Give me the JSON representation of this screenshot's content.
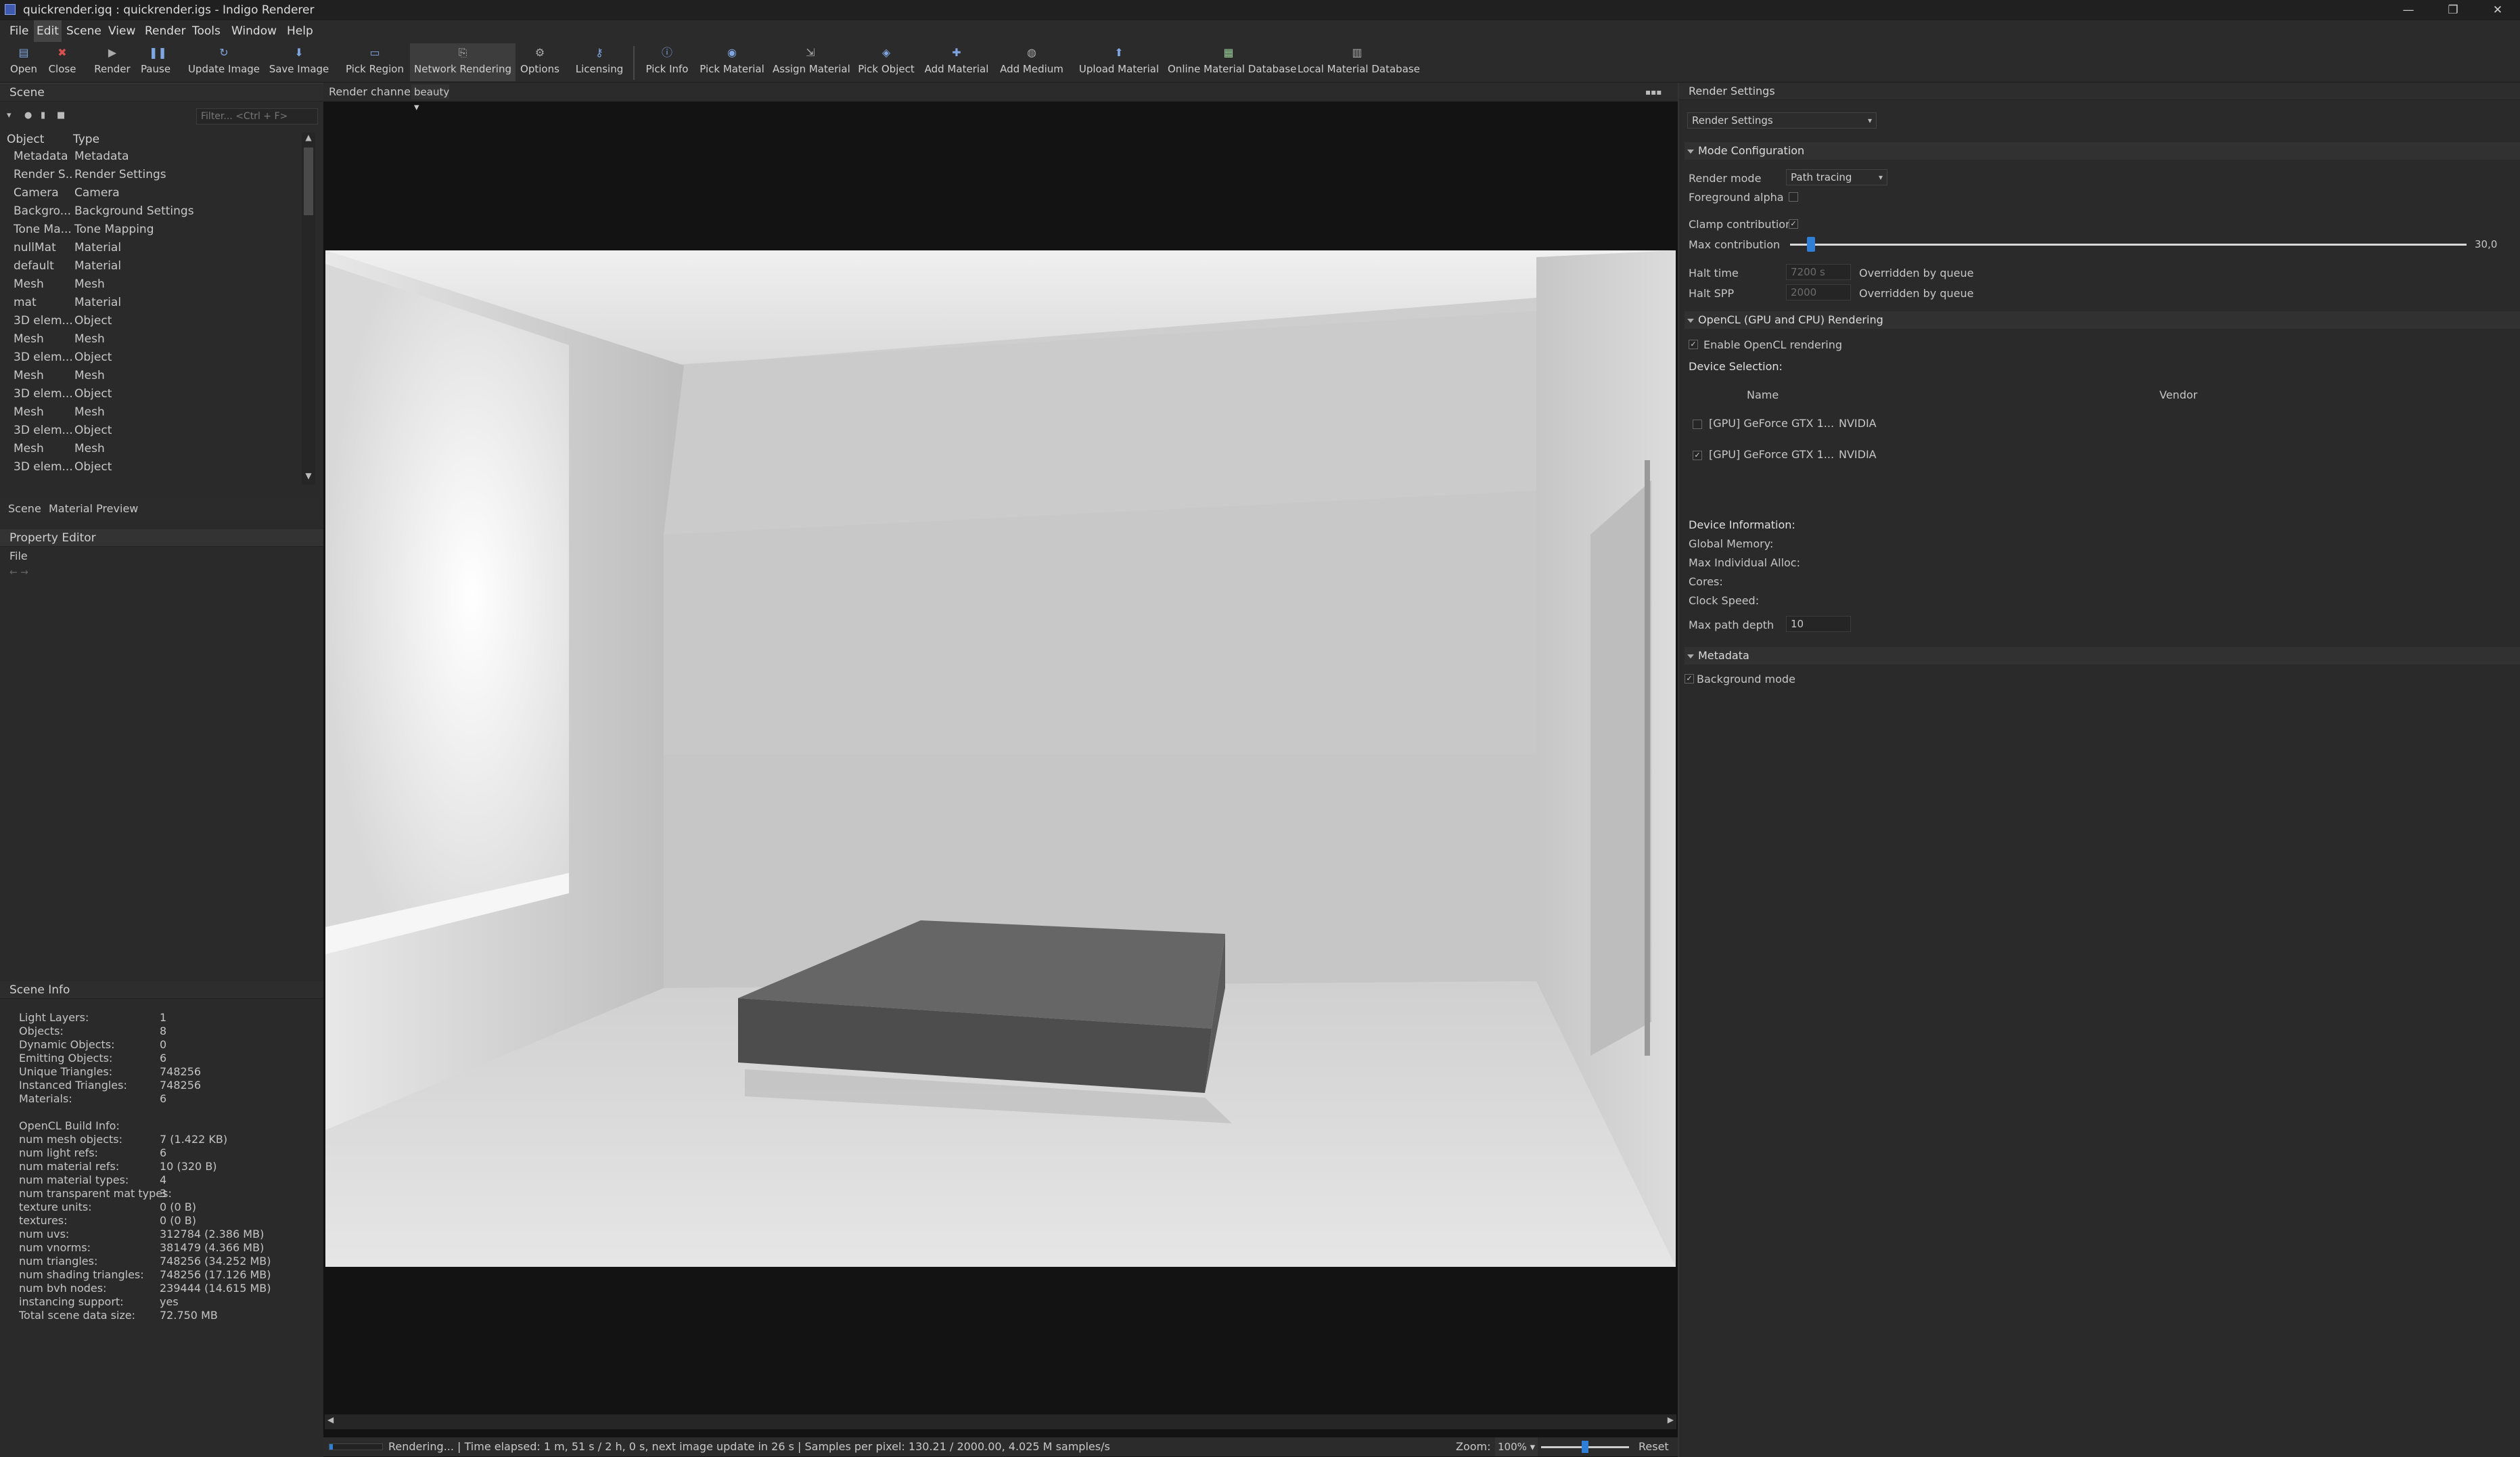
{
  "window": {
    "title": "quickrender.igq : quickrender.igs - Indigo Renderer",
    "controls": [
      "—",
      "❐",
      "✕"
    ]
  },
  "menu": [
    "File",
    "Edit",
    "Scene",
    "View",
    "Render",
    "Tools",
    "Window",
    "Help"
  ],
  "toolbar": {
    "buttons": [
      {
        "label": "Open",
        "icon": "folder-open-icon"
      },
      {
        "label": "Close",
        "icon": "close-icon"
      },
      {
        "label": "Render",
        "icon": "play-icon"
      },
      {
        "label": "Pause",
        "icon": "pause-icon"
      },
      {
        "label": "Update Image",
        "icon": "refresh-icon"
      },
      {
        "label": "Save Image",
        "icon": "save-icon"
      },
      {
        "label": "Pick Region",
        "icon": "region-icon"
      },
      {
        "label": "Network Rendering",
        "icon": "network-icon"
      },
      {
        "label": "Options",
        "icon": "gear-icon"
      },
      {
        "label": "Licensing",
        "icon": "key-icon"
      },
      {
        "label": "Pick Info",
        "icon": "info-icon"
      },
      {
        "label": "Pick Material",
        "icon": "material-icon"
      },
      {
        "label": "Assign Material",
        "icon": "assign-icon"
      },
      {
        "label": "Pick Object",
        "icon": "object-icon"
      },
      {
        "label": "Add Material",
        "icon": "add-material-icon"
      },
      {
        "label": "Add Medium",
        "icon": "medium-icon"
      },
      {
        "label": "Upload Material",
        "icon": "upload-icon"
      },
      {
        "label": "Online Material Database",
        "icon": "grid-icon"
      },
      {
        "label": "Local Material Database",
        "icon": "database-icon"
      }
    ]
  },
  "scene": {
    "panel_title": "Scene",
    "filter_placeholder": "Filter... <Ctrl + F>",
    "col_object": "Object",
    "col_type": "Type",
    "rows": [
      {
        "object": "Metadata",
        "type": "Metadata"
      },
      {
        "object": "Render S...",
        "type": "Render Settings"
      },
      {
        "object": "Camera",
        "type": "Camera"
      },
      {
        "object": "Backgro...",
        "type": "Background Settings"
      },
      {
        "object": "Tone Ma...",
        "type": "Tone Mapping"
      },
      {
        "object": "nullMat",
        "type": "Material"
      },
      {
        "object": "default",
        "type": "Material"
      },
      {
        "object": "Mesh",
        "type": "Mesh"
      },
      {
        "object": "mat",
        "type": "Material"
      },
      {
        "object": "3D elem...",
        "type": "Object"
      },
      {
        "object": "Mesh",
        "type": "Mesh"
      },
      {
        "object": "3D elem...",
        "type": "Object"
      },
      {
        "object": "Mesh",
        "type": "Mesh"
      },
      {
        "object": "3D elem...",
        "type": "Object"
      },
      {
        "object": "Mesh",
        "type": "Mesh"
      },
      {
        "object": "3D elem...",
        "type": "Object"
      },
      {
        "object": "Mesh",
        "type": "Mesh"
      },
      {
        "object": "3D elem...",
        "type": "Object"
      }
    ],
    "tabs": [
      "Scene",
      "Material Preview"
    ]
  },
  "property_editor": {
    "title": "Property Editor",
    "menu": "File",
    "nav": "← →"
  },
  "scene_info": {
    "title": "Scene Info",
    "rows": [
      {
        "k": "Light Layers:",
        "v": "1"
      },
      {
        "k": "Objects:",
        "v": "8"
      },
      {
        "k": "Dynamic Objects:",
        "v": "0"
      },
      {
        "k": "Emitting Objects:",
        "v": "6"
      },
      {
        "k": "Unique Triangles:",
        "v": "748256"
      },
      {
        "k": "Instanced Triangles:",
        "v": "748256"
      },
      {
        "k": "Materials:",
        "v": "6"
      },
      {
        "k": "",
        "v": ""
      },
      {
        "k": "OpenCL Build Info:",
        "v": ""
      },
      {
        "k": "num mesh objects:",
        "v": "7 (1.422 KB)"
      },
      {
        "k": "num light refs:",
        "v": "6"
      },
      {
        "k": "num material refs:",
        "v": "10 (320 B)"
      },
      {
        "k": "num material types:",
        "v": "4"
      },
      {
        "k": "num transparent mat types:",
        "v": "3"
      },
      {
        "k": "texture units:",
        "v": "0 (0 B)"
      },
      {
        "k": "textures:",
        "v": "0 (0 B)"
      },
      {
        "k": "num uvs:",
        "v": "312784 (2.386 MB)"
      },
      {
        "k": "num vnorms:",
        "v": "381479 (4.366 MB)"
      },
      {
        "k": "num triangles:",
        "v": "748256 (34.252 MB)"
      },
      {
        "k": "num shading triangles:",
        "v": "748256 (17.126 MB)"
      },
      {
        "k": "num bvh nodes:",
        "v": "239444 (14.615 MB)"
      },
      {
        "k": "instancing support:",
        "v": "yes"
      },
      {
        "k": "Total scene data size:",
        "v": "72.750 MB"
      }
    ]
  },
  "viewport": {
    "channel_label": "Render channel:",
    "channel_value": "beauty",
    "status": "Rendering... | Time elapsed: 1 m, 51 s / 2 h, 0 s, next image update in 26 s | Samples per pixel: 130.21 / 2000.00, 4.025 M samples/s",
    "zoom_label": "Zoom:",
    "zoom_value": "100%",
    "reset": "Reset"
  },
  "render_settings": {
    "title": "Render Settings",
    "selector": "Render Settings",
    "mode_config": "Mode Configuration",
    "render_mode_label": "Render mode",
    "render_mode_value": "Path tracing",
    "foreground_alpha": "Foreground alpha",
    "clamp_contributions": "Clamp contributions",
    "max_contribution": "Max contribution",
    "max_contribution_value": "30,0",
    "max_contribution_fraction": 0.025,
    "halt_time": "Halt time",
    "halt_time_value": "7200 s",
    "halt_spp": "Halt SPP",
    "halt_spp_value": "2000",
    "overridden": "Overridden by queue",
    "opencl_section": "OpenCL (GPU and CPU) Rendering",
    "enable_opencl": "Enable OpenCL rendering",
    "device_selection": "Device Selection:",
    "col_name": "Name",
    "col_vendor": "Vendor",
    "devices": [
      {
        "name": "[GPU] GeForce GTX 1...",
        "vendor": "NVIDIA",
        "checked": false
      },
      {
        "name": "[GPU] GeForce GTX 1...",
        "vendor": "NVIDIA",
        "checked": true
      }
    ],
    "device_info": "Device Information:",
    "global_memory": "Global Memory:",
    "max_alloc": "Max Individual Alloc:",
    "cores": "Cores:",
    "clock": "Clock Speed:",
    "max_path_depth": "Max path depth",
    "max_path_depth_value": "10",
    "metadata_section": "Metadata",
    "background_mode": "Background mode"
  },
  "colors": {
    "accent": "#2f7fd6",
    "background": "#2a2a2a",
    "viewport": "#131313"
  }
}
